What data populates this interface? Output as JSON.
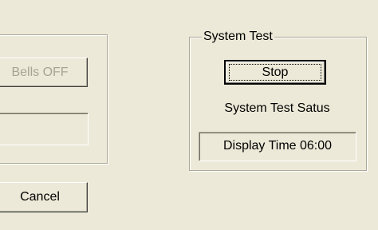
{
  "left_panel": {
    "bells_off_label": "Bells OFF",
    "text_field_value": ""
  },
  "cancel_label": "Cancel",
  "system_test": {
    "group_title": "System Test",
    "stop_label": "Stop",
    "status_label": "System Test Satus",
    "display_time": "Display Time 06:00"
  }
}
